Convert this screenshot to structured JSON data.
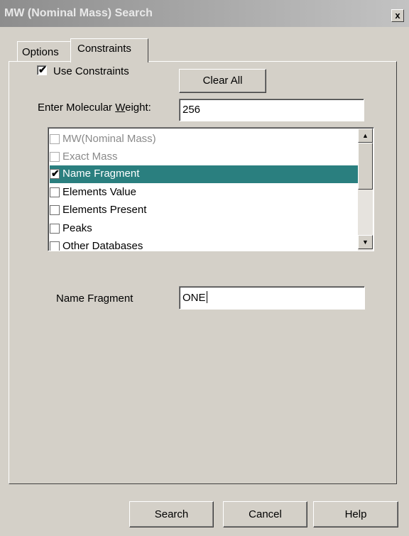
{
  "window": {
    "title": "MW (Nominal Mass) Search",
    "close_glyph": "x"
  },
  "tabs": [
    {
      "label": "Options",
      "active": false
    },
    {
      "label": "Constraints",
      "active": true
    }
  ],
  "constraints": {
    "use_constraints_label": "Use Constraints",
    "use_constraints_checked": true,
    "clear_all_label": "Clear All",
    "mw_label_pre": "Enter Molecular ",
    "mw_label_accel": "W",
    "mw_label_post": "eight:",
    "mw_value": "256",
    "list_items": [
      {
        "label": "MW(Nominal Mass)",
        "checked": false,
        "disabled": true,
        "selected": false
      },
      {
        "label": "Exact Mass",
        "checked": false,
        "disabled": true,
        "selected": false
      },
      {
        "label": "Name Fragment",
        "checked": true,
        "disabled": false,
        "selected": true
      },
      {
        "label": "Elements Value",
        "checked": false,
        "disabled": false,
        "selected": false
      },
      {
        "label": "Elements Present",
        "checked": false,
        "disabled": false,
        "selected": false
      },
      {
        "label": "Peaks",
        "checked": false,
        "disabled": false,
        "selected": false
      },
      {
        "label": "Other Databases",
        "checked": false,
        "disabled": false,
        "selected": false
      }
    ],
    "name_fragment_label": "Name Fragment",
    "name_fragment_value": "ONE"
  },
  "footer": {
    "search_label": "Search",
    "cancel_label": "Cancel",
    "help_label": "Help"
  },
  "icons": {
    "checkmark": "✔",
    "scroll_up": "▲",
    "scroll_down": "▼"
  }
}
